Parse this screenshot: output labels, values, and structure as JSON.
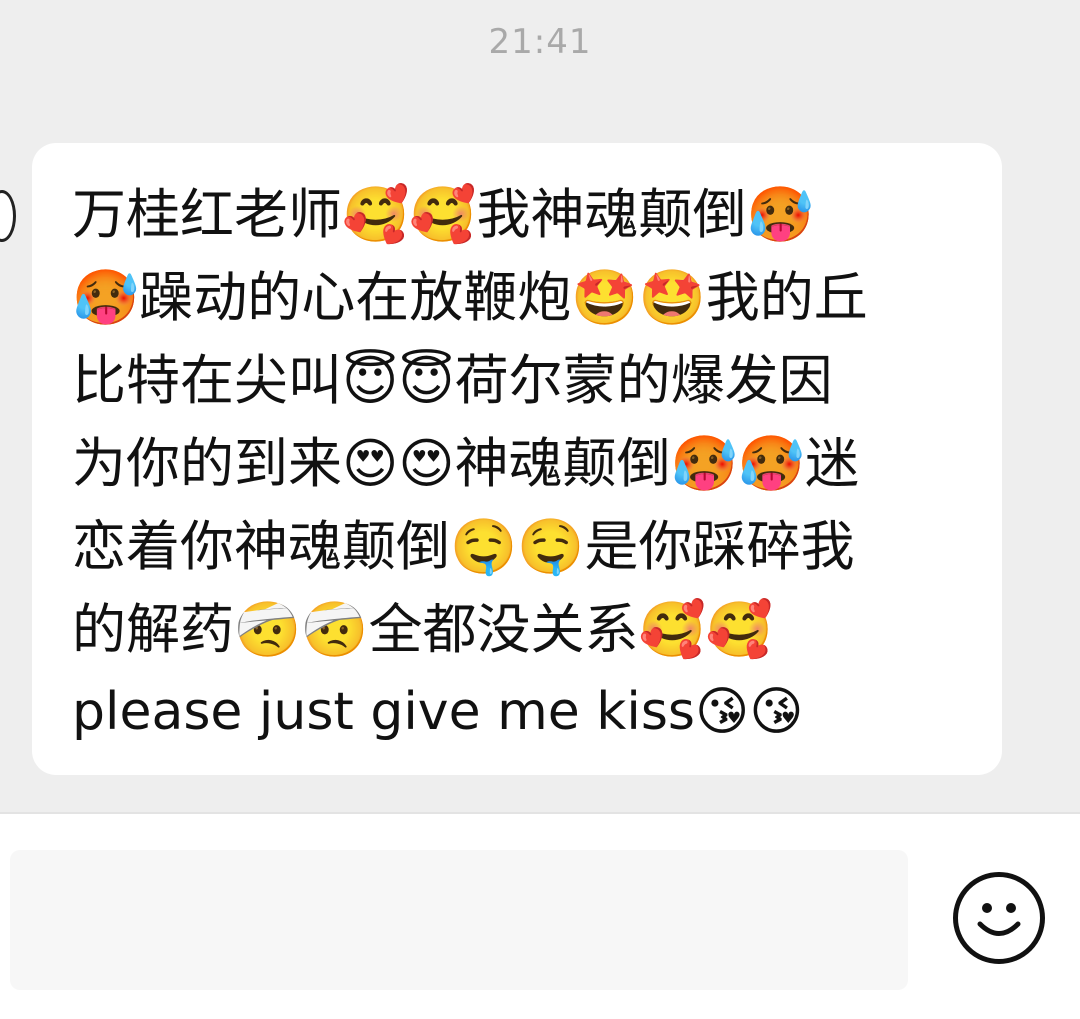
{
  "chat": {
    "timestamp": "21:41",
    "message": {
      "lines": [
        "万桂红老师🥰🥰我神魂颠倒🥵",
        "🥵躁动的心在放鞭炮🤩🤩我的丘",
        "比特在尖叫😇😇荷尔蒙的爆发因",
        "为你的到来😍😍神魂颠倒🥵🥵迷",
        "恋着你神魂颠倒🤤🤤是你踩碎我",
        "的解药🤕🤕全都没关系🥰🥰",
        "please just give me kiss😘😘"
      ]
    }
  },
  "input_bar": {
    "emoji_button_icon": "smiley-face-icon"
  },
  "colors": {
    "chat_background": "#eeeeee",
    "bubble_background": "#ffffff",
    "timestamp": "#a9a9a9",
    "text": "#111111"
  }
}
